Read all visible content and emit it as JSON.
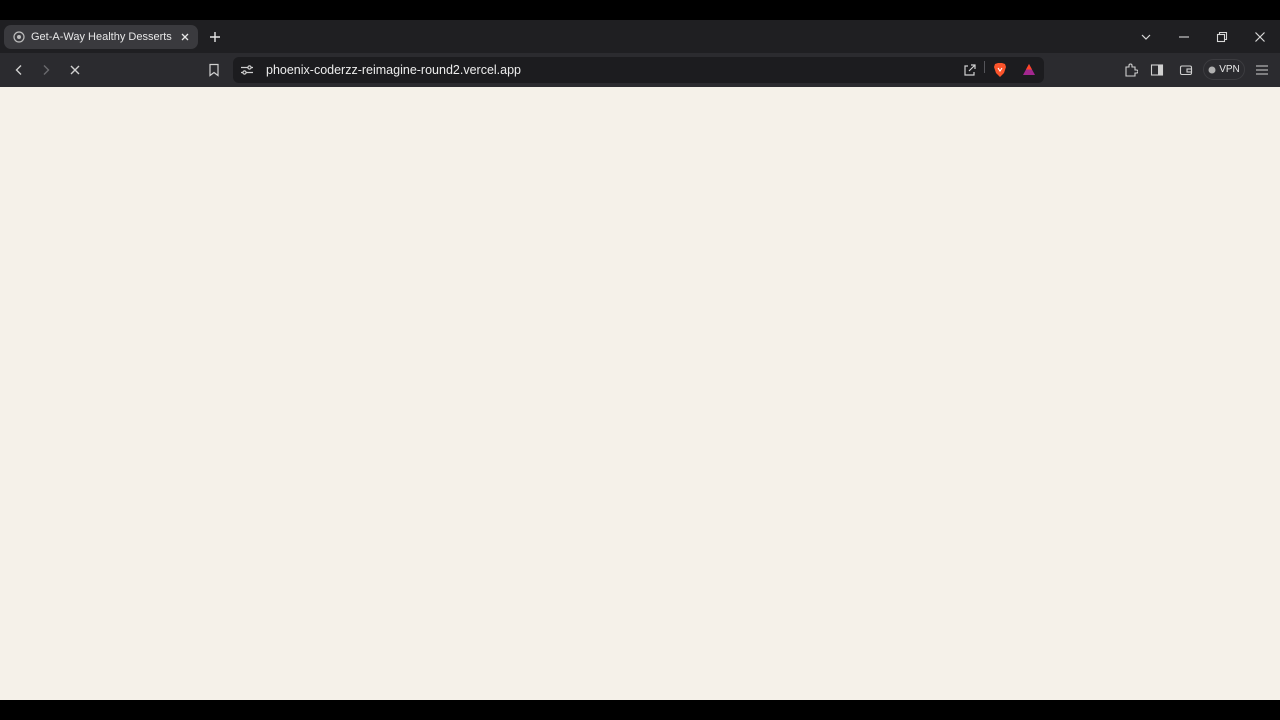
{
  "browser": {
    "tabs": [
      {
        "title": "Get-A-Way Healthy Desserts",
        "favicon": "globe-icon",
        "active": true
      }
    ],
    "new_tab_icon": "plus-icon",
    "window_controls": [
      "tab-search-icon",
      "minimize-icon",
      "restore-icon",
      "close-icon"
    ],
    "toolbar": {
      "back_icon": "chevron-left-icon",
      "forward_icon": "chevron-right-icon",
      "stop_icon": "stop-loading-icon",
      "bookmark_icon": "bookmark-icon",
      "site_info_icon": "site-settings-icon",
      "url": "phoenix-coderzz-reimagine-round2.vercel.app",
      "share_icon": "share-icon",
      "shields_icon": "brave-shields-icon",
      "rewards_icon": "brave-rewards-icon",
      "extensions_icon": "extensions-icon",
      "sidebar_icon": "sidebar-icon",
      "wallet_icon": "wallet-icon",
      "vpn_label": "VPN",
      "menu_icon": "hamburger-menu-icon"
    }
  },
  "page": {
    "background": "#f5f1e9"
  },
  "colors": {
    "brave_orange": "#fb542b",
    "rewards_purple": "#a3278f",
    "rewards_orange": "#ff4724"
  }
}
